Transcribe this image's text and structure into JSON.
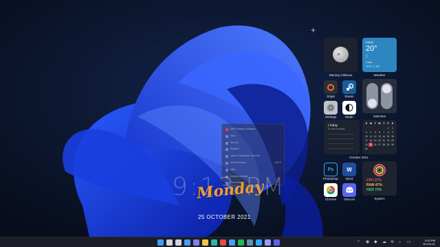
{
  "context_menu": {
    "items": [
      {
        "label": "AMD Radeon Software",
        "icon": "amd-icon",
        "shortcut": ""
      },
      {
        "label": "View",
        "icon": "view-icon",
        "shortcut": ""
      },
      {
        "label": "Sort by",
        "icon": "sort-icon",
        "shortcut": ""
      },
      {
        "label": "Refresh",
        "icon": "refresh-icon",
        "shortcut": ""
      },
      {
        "label": "Open in Windows Terminal",
        "icon": "terminal-icon",
        "shortcut": ""
      },
      {
        "label": "Undo Rename",
        "icon": "undo-icon",
        "shortcut": "Ctrl+Z"
      },
      {
        "label": "New",
        "icon": "new-icon",
        "shortcut": ""
      },
      {
        "label": "Display settings",
        "icon": "display-icon",
        "shortcut": ""
      },
      {
        "label": "Personalize",
        "icon": "personalize-icon",
        "shortcut": ""
      }
    ]
  },
  "clock": {
    "time": "9:13 PM",
    "day": "Monday",
    "date": "25 OCTOBER 2021"
  },
  "widgets": {
    "moon": {
      "label": "Waning Gibbous",
      "icon": "moon-icon"
    },
    "weather": {
      "label": "Weather",
      "city": "Kasui",
      "temp": "20°",
      "icon": "moon-clear-icon",
      "condition": "Clear",
      "hi_lo": "H 21° L 16°"
    },
    "apps": [
      {
        "label": "Origin",
        "icon": "origin-icon",
        "color": "#2c2f38",
        "accent": "#f56c2d"
      },
      {
        "label": "Steam",
        "icon": "steam-icon",
        "color": "#1b5d99",
        "accent": "#ffffff"
      },
      {
        "label": "Settings",
        "icon": "settings-icon",
        "color": "#bfc3c9",
        "accent": "#555555"
      },
      {
        "label": "Mode",
        "icon": "mode-icon",
        "color": "#ffffff",
        "accent": "#111111"
      }
    ],
    "switches": {
      "label": "Switches"
    },
    "agenda": {
      "today": "| Today",
      "task": "Do the Laundry"
    },
    "calendar": {
      "label": "October 2021",
      "weekdays": [
        "S",
        "M",
        "T",
        "W",
        "T",
        "F",
        "S"
      ],
      "weeks": [
        [
          "",
          "",
          "",
          "",
          "",
          "1",
          "2"
        ],
        [
          "3",
          "4",
          "5",
          "6",
          "7",
          "8",
          "9"
        ],
        [
          "10",
          "11",
          "12",
          "13",
          "14",
          "15",
          "16"
        ],
        [
          "17",
          "18",
          "19",
          "20",
          "21",
          "22",
          "23"
        ],
        [
          "24",
          "25",
          "26",
          "27",
          "28",
          "29",
          "30"
        ],
        [
          "31",
          "",
          "",
          "",
          "",
          "",
          ""
        ]
      ],
      "today": "25"
    },
    "apps2": [
      {
        "label": "Photoshop",
        "icon": "photoshop-icon",
        "glyph": "Ps",
        "color": "#0a1a2f",
        "accent": "#31a8ff"
      },
      {
        "label": "Word",
        "icon": "word-icon",
        "glyph": "W",
        "color": "#1f4e9a",
        "accent": "#ffffff"
      },
      {
        "label": "Chrome",
        "icon": "chrome-icon",
        "glyph": "",
        "color": "#ffffff",
        "accent": "#4285f4"
      },
      {
        "label": "Discord",
        "icon": "discord-icon",
        "glyph": "",
        "color": "#5865f2",
        "accent": "#ffffff"
      }
    ],
    "system": {
      "label": "System",
      "cpu": "CPU 27%",
      "ram": "RAM 47%",
      "hdd": "HDD 73%",
      "cpu_color": "#e25b74",
      "ram_color": "#f4c444",
      "hdd_color": "#56d17c"
    }
  },
  "taskbar": {
    "apps": [
      {
        "name": "start-icon",
        "color": "#3aa0ff"
      },
      {
        "name": "search-icon",
        "color": "#d0d4dc"
      },
      {
        "name": "task-view-icon",
        "color": "#d0d4dc"
      },
      {
        "name": "widgets-icon",
        "color": "#4a9cf7"
      },
      {
        "name": "chat-icon",
        "color": "#7b83eb"
      },
      {
        "name": "file-explorer-icon",
        "color": "#f2c14e"
      },
      {
        "name": "edge-icon",
        "color": "#2fb5a6"
      },
      {
        "name": "chrome-icon",
        "color": "#e74c3c"
      },
      {
        "name": "store-icon",
        "color": "#4a9cf7"
      },
      {
        "name": "spotify-icon",
        "color": "#1db954"
      },
      {
        "name": "steam-icon",
        "color": "#6a8fb3"
      },
      {
        "name": "photoshop-icon",
        "color": "#31a8ff"
      },
      {
        "name": "premiere-icon",
        "color": "#9999ff"
      },
      {
        "name": "discord-icon",
        "color": "#5865f2"
      }
    ],
    "time": "9:13 PM",
    "date": "25-Oct-21"
  }
}
